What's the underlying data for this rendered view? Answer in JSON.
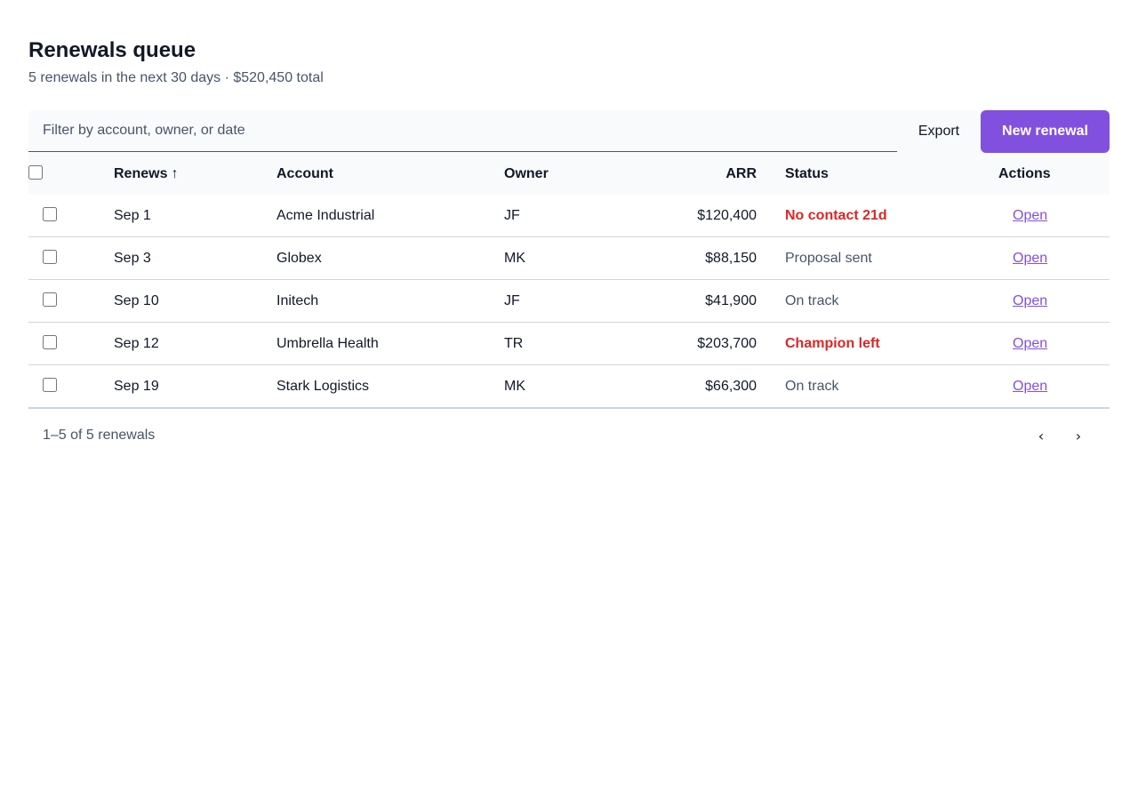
{
  "header": {
    "title": "Renewals queue",
    "subtitle": "5 renewals in the next 30 days · $520,450 total"
  },
  "toolbar": {
    "filter_placeholder": "Filter by account, owner, or date",
    "filter_value": "",
    "export_label": "Export",
    "new_label": "New renewal"
  },
  "table": {
    "columns": {
      "renews": "Renews",
      "sort_indicator": "↑",
      "account": "Account",
      "owner": "Owner",
      "arr": "ARR",
      "status": "Status",
      "actions": "Actions"
    },
    "rows": [
      {
        "renews": "Sep 1",
        "account": "Acme Industrial",
        "owner": "JF",
        "arr": "$120,400",
        "status": "No contact 21d",
        "status_kind": "risk",
        "action": "Open"
      },
      {
        "renews": "Sep 3",
        "account": "Globex",
        "owner": "MK",
        "arr": "$88,150",
        "status": "Proposal sent",
        "status_kind": "neutral",
        "action": "Open"
      },
      {
        "renews": "Sep 10",
        "account": "Initech",
        "owner": "JF",
        "arr": "$41,900",
        "status": "On track",
        "status_kind": "neutral",
        "action": "Open"
      },
      {
        "renews": "Sep 12",
        "account": "Umbrella Health",
        "owner": "TR",
        "arr": "$203,700",
        "status": "Champion left",
        "status_kind": "risk",
        "action": "Open"
      },
      {
        "renews": "Sep 19",
        "account": "Stark Logistics",
        "owner": "MK",
        "arr": "$66,300",
        "status": "On track",
        "status_kind": "neutral",
        "action": "Open"
      }
    ]
  },
  "footer": {
    "range_text": "1–5 of 5 renewals",
    "prev_label": "‹",
    "next_label": "›"
  },
  "colors": {
    "accent": "#8250df",
    "risk": "#dc2626",
    "muted": "#475569"
  }
}
